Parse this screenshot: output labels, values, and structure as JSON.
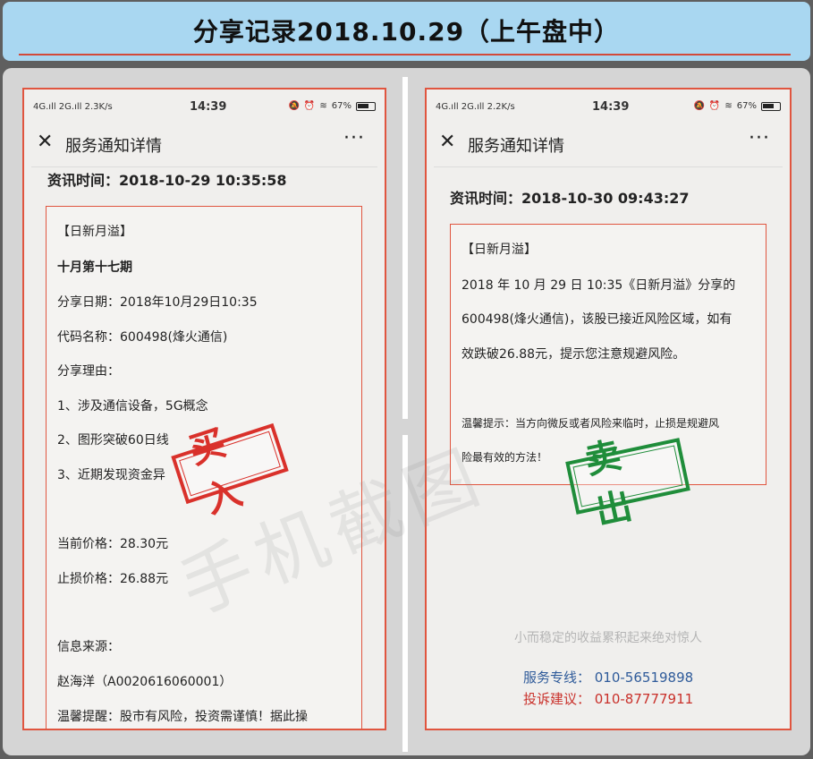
{
  "banner": {
    "title": "分享记录2018.10.29（上午盘中）"
  },
  "watermark": "手机截图",
  "left_phone": {
    "status": {
      "network": "4G.ıll 2G.ıll 2.3K/s",
      "time": "14:39",
      "battery": "67%"
    },
    "nav": {
      "close_icon": "close-icon",
      "title": "服务通知详情",
      "more": "···"
    },
    "info_time": "资讯时间：2018-10-29 10:35:58",
    "card_lines": [
      "【日新月溢】",
      "十月第十七期",
      "分享日期：2018年10月29日10:35",
      "代码名称：600498(烽火通信)",
      "分享理由：",
      "1、涉及通信设备，5G概念",
      "2、图形突破60日线",
      "3、近期发现资金异",
      "当前价格：28.30元",
      "止损价格：26.88元",
      "信息来源：",
      "赵海洋（A0020616060001）",
      "温馨提醒：股市有风险，投资需谨慎！据此操"
    ],
    "stamp": "买入"
  },
  "right_phone": {
    "status": {
      "network": "4G.ıll 2G.ıll 2.2K/s",
      "time": "14:39",
      "battery": "67%"
    },
    "nav": {
      "close_icon": "close-icon",
      "title": "服务通知详情",
      "more": "···"
    },
    "info_time": "资讯时间：2018-10-30 09:43:27",
    "card_lines": [
      "【日新月溢】",
      "2018 年 10 月 29 日 10:35《日新月溢》分享的",
      "600498(烽火通信)，该股已接近风险区域，如有",
      "效跌破26.88元，提示您注意规避风险。",
      "温馨提示：当方向微反或者风险来临时，止损是规避风",
      "险最有效的方法！"
    ],
    "stamp": "卖出",
    "slogan": "小而稳定的收益累积起来绝对惊人",
    "service_line": "服务专线：  010-56519898",
    "complaint_line": "投诉建议：  010-87777911"
  },
  "colors": {
    "accent_red": "#e0553f",
    "buy_red": "#d9312b",
    "sell_green": "#1f8d3a",
    "banner_blue": "#a9d7f1"
  }
}
